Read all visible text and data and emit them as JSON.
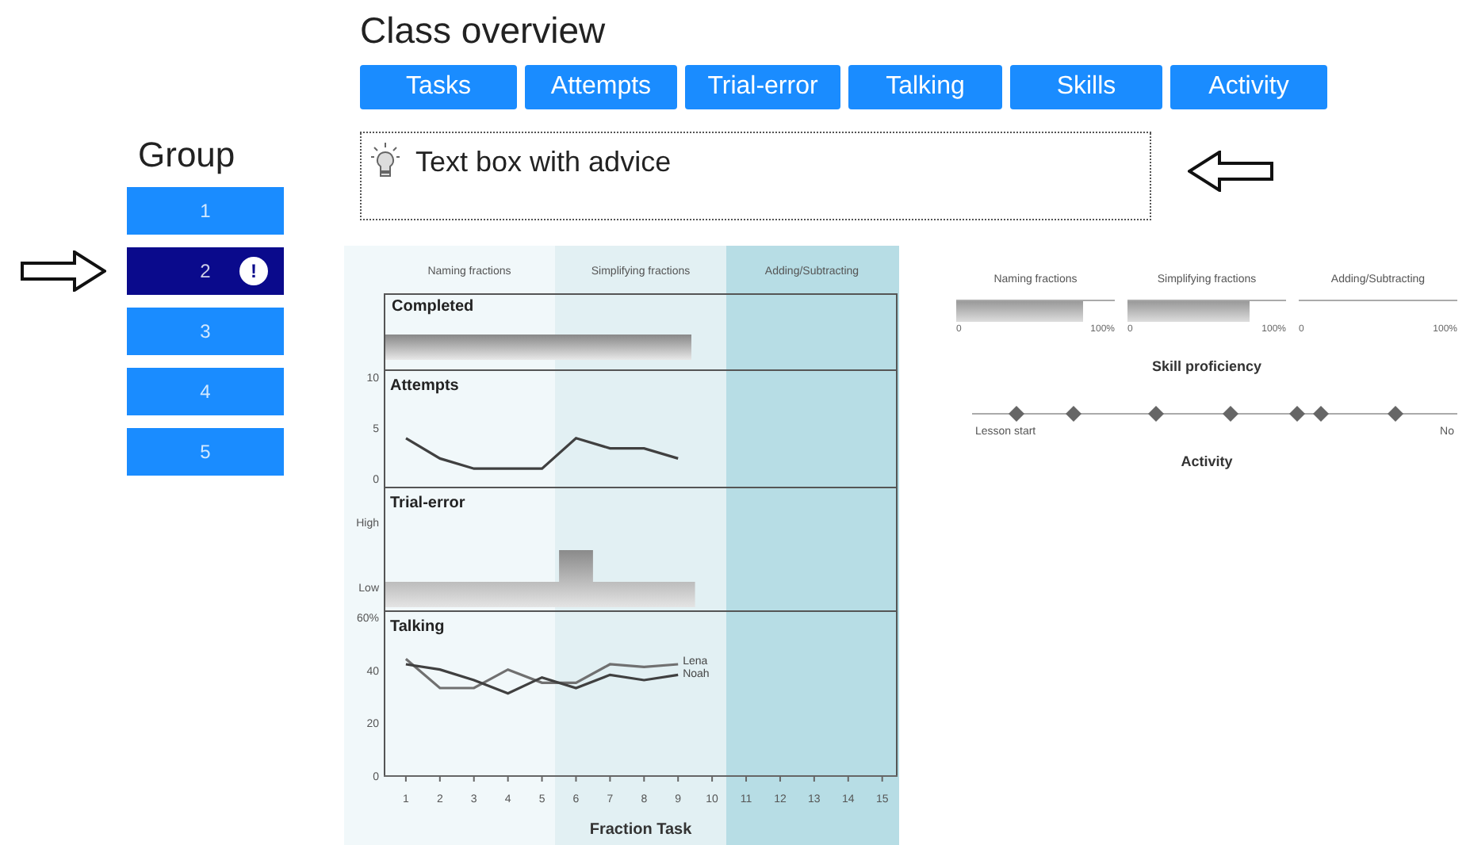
{
  "title": "Class overview",
  "tabs": [
    {
      "label": "Tasks",
      "selected": false
    },
    {
      "label": "Attempts",
      "selected": false
    },
    {
      "label": "Trial-error",
      "selected": false
    },
    {
      "label": "Talking",
      "selected": false
    },
    {
      "label": "Skills",
      "selected": false
    },
    {
      "label": "Activity",
      "selected": false
    }
  ],
  "advice": {
    "text": "Text box with advice"
  },
  "groups": {
    "title": "Group",
    "items": [
      {
        "label": "1",
        "selected": false,
        "alert": false
      },
      {
        "label": "2",
        "selected": true,
        "alert": true,
        "alert_text": "!"
      },
      {
        "label": "3",
        "selected": false,
        "alert": false
      },
      {
        "label": "4",
        "selected": false,
        "alert": false
      },
      {
        "label": "5",
        "selected": false,
        "alert": false
      }
    ]
  },
  "task_chart": {
    "sections": [
      {
        "label": "Naming fractions",
        "highlighted": false
      },
      {
        "label": "Simplifying fractions",
        "highlighted": false
      },
      {
        "label": "Adding/Subtracting",
        "highlighted": true
      }
    ],
    "completed": {
      "title": "Completed",
      "level": 0.6
    },
    "attempts": {
      "title": "Attempts",
      "chart_data": {
        "type": "line",
        "categories": [
          null,
          null,
          null,
          null,
          null,
          null,
          null,
          null,
          null
        ],
        "series": [
          {
            "color": "#404040",
            "values": [
              4,
              2,
              1,
              1,
              1,
              4,
              3,
              3,
              2
            ]
          }
        ],
        "ylim": [
          0,
          10
        ],
        "yticks": [
          0,
          5,
          10
        ]
      }
    },
    "trial_error": {
      "title": "Trial-error",
      "y_labels": [
        "High",
        "Low"
      ]
    },
    "talking": {
      "title": "Talking",
      "chart_data": {
        "type": "line",
        "xlabel": "Fraction Task",
        "x": [
          1,
          2,
          3,
          4,
          5,
          6,
          7,
          8,
          9
        ],
        "xlim": [
          0.35,
          15.45
        ],
        "ylim": [
          0,
          62.4
        ],
        "xticks": [
          1,
          2,
          3,
          4,
          5,
          6,
          7,
          8,
          9,
          10,
          11,
          12,
          13,
          14,
          15
        ],
        "yticks": [
          0,
          20,
          40,
          {
            "value": 60,
            "label": "60%"
          }
        ],
        "series": [
          {
            "name": "Lena",
            "color": "#707070",
            "values": [
              44,
              33,
              33,
              40,
              35,
              35,
              42,
              41,
              42
            ]
          },
          {
            "name": "Noah",
            "color": "#404040",
            "values": [
              42,
              40,
              36,
              31,
              37,
              33,
              38,
              36,
              38
            ]
          }
        ]
      }
    }
  },
  "skills": {
    "title": "Skill proficiency",
    "items": [
      {
        "label": "Naming fractions",
        "level": 0.8,
        "min": "0",
        "max": "100%"
      },
      {
        "label": "Simplifying fractions",
        "level": 0.77,
        "min": "0",
        "max": "100%"
      },
      {
        "label": "Adding/Subtracting",
        "min": "0",
        "max": "100%"
      }
    ]
  },
  "activity": {
    "title": "Activity",
    "start": "Lesson start",
    "end": "No"
  }
}
